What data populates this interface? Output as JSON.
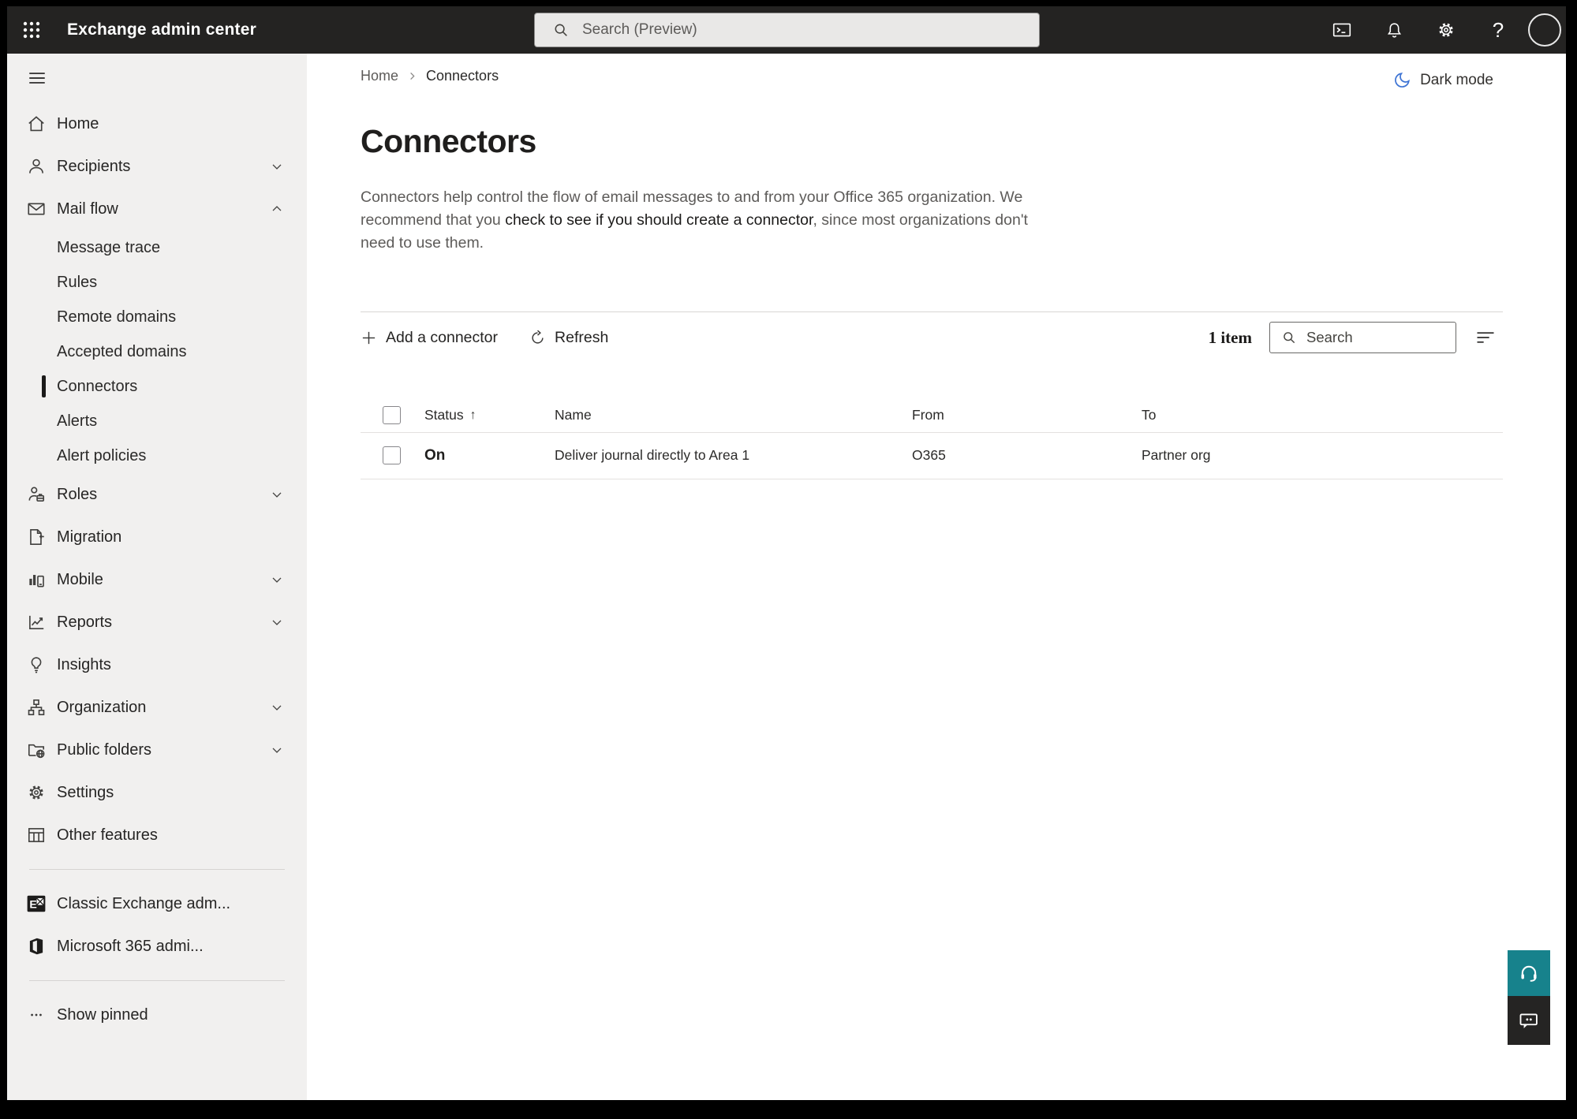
{
  "colors": {
    "topbar_bg": "#242322",
    "sidebar_bg": "#f1f0ef",
    "accent_teal": "#17828c",
    "moon_blue": "#3e74d4",
    "selected_indicator": "#1b1a19"
  },
  "topbar": {
    "title": "Exchange admin center",
    "search_placeholder": "Search (Preview)"
  },
  "breadcrumb": {
    "home": "Home",
    "current": "Connectors"
  },
  "dark_mode_label": "Dark mode",
  "page": {
    "title": "Connectors",
    "desc_before": "Connectors help control the flow of email messages to and from your Office 365 organization. We recommend that you ",
    "desc_link": "check to see if you should create a connector",
    "desc_after": ", since most organizations don't need to use them."
  },
  "toolbar": {
    "add_label": "Add a connector",
    "refresh_label": "Refresh",
    "item_count": "1 item",
    "search_placeholder": "Search"
  },
  "table": {
    "headers": [
      "Status",
      "Name",
      "From",
      "To"
    ],
    "sort_icon": "↑",
    "rows": [
      {
        "status": "On",
        "name": "Deliver journal directly to Area 1",
        "from": "O365",
        "to": "Partner org"
      }
    ]
  },
  "icons": {
    "help": "?"
  },
  "sidebar": {
    "items": [
      {
        "label": "Home"
      },
      {
        "label": "Recipients",
        "chevron": "down"
      },
      {
        "label": "Mail flow",
        "chevron": "up",
        "expanded": true
      },
      {
        "label": "Message trace"
      },
      {
        "label": "Rules"
      },
      {
        "label": "Remote domains"
      },
      {
        "label": "Accepted domains"
      },
      {
        "label": "Connectors",
        "selected": true
      },
      {
        "label": "Alerts"
      },
      {
        "label": "Alert policies"
      },
      {
        "label": "Roles",
        "chevron": "down"
      },
      {
        "label": "Migration"
      },
      {
        "label": "Mobile",
        "chevron": "down"
      },
      {
        "label": "Reports",
        "chevron": "down"
      },
      {
        "label": "Insights"
      },
      {
        "label": "Organization",
        "chevron": "down"
      },
      {
        "label": "Public folders",
        "chevron": "down"
      },
      {
        "label": "Settings"
      },
      {
        "label": "Other features"
      },
      {
        "label": "Classic Exchange adm..."
      },
      {
        "label": "Microsoft 365 admi..."
      },
      {
        "label": "Show pinned"
      }
    ]
  }
}
